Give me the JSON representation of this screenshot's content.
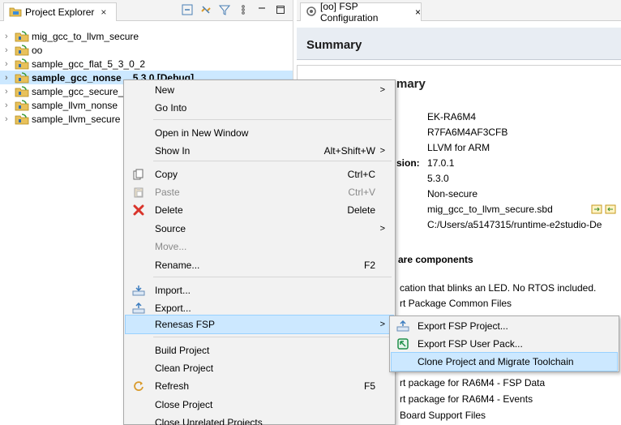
{
  "explorer": {
    "tab_label": "Project Explorer",
    "close_glyph": "×",
    "projects": [
      {
        "name": "mig_gcc_to_llvm_secure",
        "selected": false
      },
      {
        "name": "oo",
        "selected": false
      },
      {
        "name": "sample_gcc_flat_5_3_0_2",
        "selected": false
      },
      {
        "name": "sample_gcc_nonse",
        "selected": true,
        "suffix": "5.3.0 [Debug]"
      },
      {
        "name": "sample_gcc_secure_",
        "selected": false
      },
      {
        "name": "sample_llvm_nonse",
        "selected": false
      },
      {
        "name": "sample_llvm_secure",
        "selected": false
      }
    ]
  },
  "editor": {
    "tab_label": "[oo] FSP Configuration",
    "close_glyph": "×",
    "header_title": "Summary",
    "subheader_prefix": "Project Summary",
    "subheader_visible": "mary",
    "values": [
      "EK-RA6M4",
      "R7FA6M4AF3CFB",
      "LLVM for ARM",
      "17.0.1",
      "5.3.0",
      "Non-secure",
      "mig_gcc_to_llvm_secure.sbd",
      "C:/Users/a5147315/runtime-e2studio-De"
    ],
    "version_key_fragment": "sion:",
    "components_heading_fragment": "are components",
    "lines_upper": [
      "cation that blinks an LED. No RTOS included.",
      "rt Package Common Files"
    ],
    "lines_lower": [
      "rt package for RA6M4 - FSP Data",
      "rt package for RA6M4 - Events",
      "Board Support Files"
    ]
  },
  "context_menu": {
    "items": [
      {
        "label": "New",
        "shortcut": "",
        "submenu": true,
        "icon": "",
        "disabled": false
      },
      {
        "label": "Go Into",
        "shortcut": "",
        "submenu": false,
        "icon": "",
        "disabled": false
      },
      {
        "label": "Open in New Window",
        "shortcut": "",
        "submenu": false,
        "icon": "",
        "disabled": false
      },
      {
        "label": "Show In",
        "shortcut": "Alt+Shift+W",
        "submenu": true,
        "icon": "",
        "disabled": false
      },
      {
        "label": "Copy",
        "shortcut": "Ctrl+C",
        "submenu": false,
        "icon": "copy-icon",
        "disabled": false
      },
      {
        "label": "Paste",
        "shortcut": "Ctrl+V",
        "submenu": false,
        "icon": "paste-icon",
        "disabled": true
      },
      {
        "label": "Delete",
        "shortcut": "Delete",
        "submenu": false,
        "icon": "delete-icon",
        "disabled": false
      },
      {
        "label": "Source",
        "shortcut": "",
        "submenu": true,
        "icon": "",
        "disabled": false
      },
      {
        "label": "Move...",
        "shortcut": "",
        "submenu": false,
        "icon": "",
        "disabled": true
      },
      {
        "label": "Rename...",
        "shortcut": "F2",
        "submenu": false,
        "icon": "",
        "disabled": false
      },
      {
        "label": "Import...",
        "shortcut": "",
        "submenu": false,
        "icon": "import-icon",
        "disabled": false
      },
      {
        "label": "Export...",
        "shortcut": "",
        "submenu": false,
        "icon": "export-icon",
        "disabled": false
      },
      {
        "label": "Renesas FSP",
        "shortcut": "",
        "submenu": true,
        "icon": "",
        "disabled": false,
        "highlighted": true
      },
      {
        "label": "Build Project",
        "shortcut": "",
        "submenu": false,
        "icon": "",
        "disabled": false
      },
      {
        "label": "Clean Project",
        "shortcut": "",
        "submenu": false,
        "icon": "",
        "disabled": false
      },
      {
        "label": "Refresh",
        "shortcut": "F5",
        "submenu": false,
        "icon": "refresh-icon",
        "disabled": false
      },
      {
        "label": "Close Project",
        "shortcut": "",
        "submenu": false,
        "icon": "",
        "disabled": false
      },
      {
        "label": "Close Unrelated Projects",
        "shortcut": "",
        "submenu": false,
        "icon": "",
        "disabled": false
      }
    ],
    "submenu_arrow": ">"
  },
  "renesas_submenu": {
    "items": [
      {
        "label": "Export FSP Project...",
        "icon": "export-fsp-icon"
      },
      {
        "label": "Export FSP User Pack...",
        "icon": "user-pack-icon"
      },
      {
        "label": "Clone Project and Migrate Toolchain",
        "icon": "",
        "highlighted": true
      }
    ]
  },
  "colors": {
    "selection": "#cce8ff",
    "menu_bg": "#f2f2f2",
    "header_bg": "#e8edf3",
    "delete_red": "#d9342b"
  }
}
